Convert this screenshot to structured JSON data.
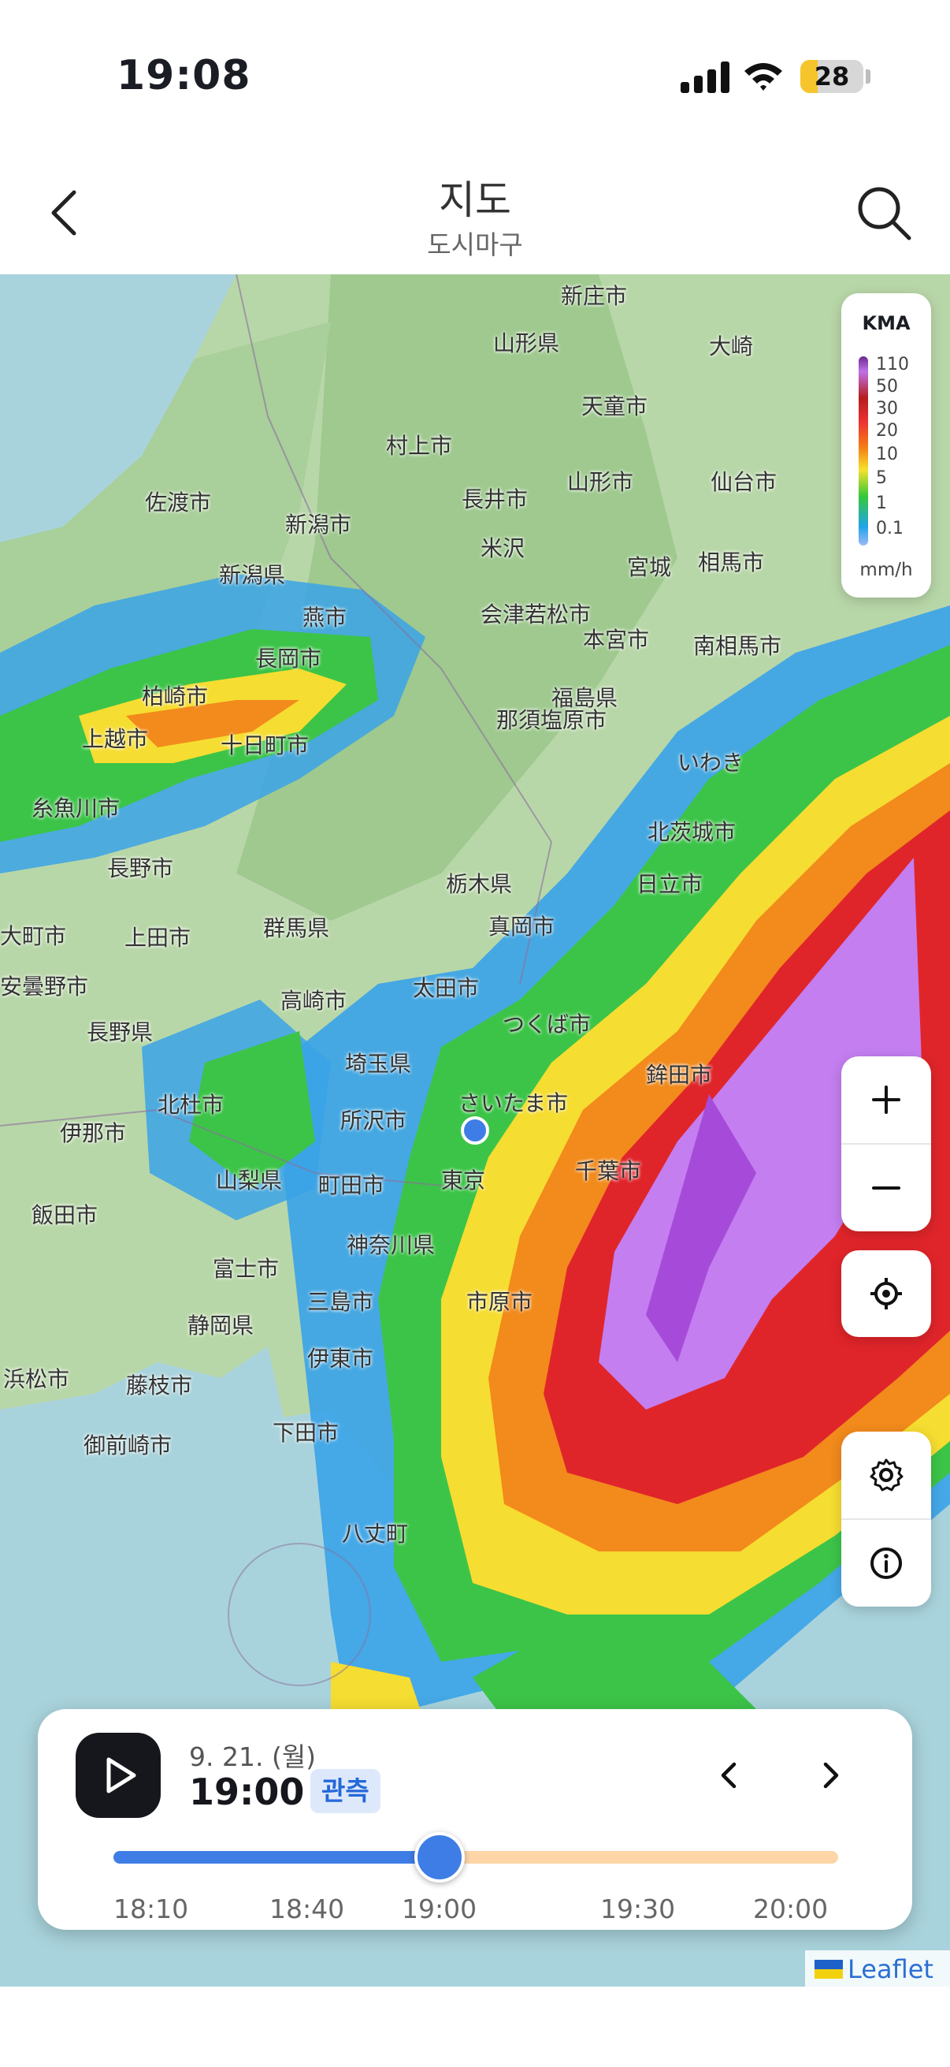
{
  "status_bar": {
    "time": "19:08",
    "battery": "28",
    "battery_level": 0.28
  },
  "header": {
    "title": "지도",
    "subtitle": "도시마구"
  },
  "legend": {
    "title": "KMA",
    "ticks": [
      "110",
      "50",
      "30",
      "20",
      "10",
      "5",
      "1",
      "0.1"
    ],
    "unit": "mm/h"
  },
  "map_labels": [
    "新庄市",
    "山形県",
    "大崎",
    "天童市",
    "村上市",
    "山形市",
    "仙台市",
    "佐渡市",
    "新潟市",
    "長井市",
    "米沢",
    "新潟県",
    "宮城",
    "相馬市",
    "燕市",
    "会津若松市",
    "本宮市",
    "南相馬市",
    "長岡市",
    "福島県",
    "柏崎市",
    "上越市",
    "十日町市",
    "那須塩原市",
    "いわき",
    "糸魚川市",
    "北茨城市",
    "長野市",
    "栃木県",
    "日立市",
    "群馬県",
    "真岡市",
    "上田市",
    "大町市",
    "安曇野市",
    "高崎市",
    "太田市",
    "つくば市",
    "長野県",
    "埼玉県",
    "鉾田市",
    "北杜市",
    "所沢市",
    "さいたま市",
    "伊那市",
    "山梨県",
    "町田市",
    "東京",
    "千葉市",
    "飯田市",
    "神奈川県",
    "富士市",
    "三島市",
    "市原市",
    "静岡県",
    "伊東市",
    "浜松市",
    "藤枝市",
    "下田市",
    "御前崎市",
    "八丈町"
  ],
  "timeline": {
    "date": "9. 21. (월)",
    "time": "19:00",
    "badge": "관측",
    "progress": 0.45,
    "ticks": [
      "18:10",
      "18:40",
      "19:00",
      "19:30",
      "20:00"
    ]
  },
  "attribution": "Leaflet",
  "colors": {
    "accent": "#3e7de6",
    "future_track": "#fdd5a6",
    "badge_bg": "#dde9fb",
    "play_button": "#15171d"
  },
  "icons": [
    "back-icon",
    "search-icon",
    "plus-icon",
    "minus-icon",
    "locate-icon",
    "settings-icon",
    "info-icon",
    "play-icon",
    "chevron-left-icon",
    "chevron-right-icon"
  ]
}
